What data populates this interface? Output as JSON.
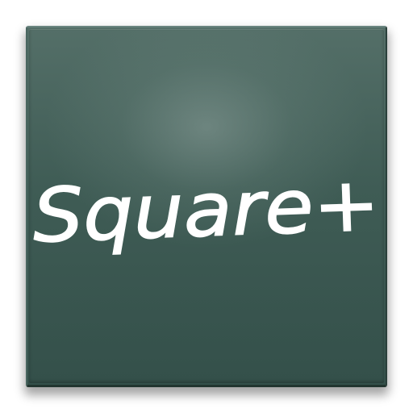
{
  "app": {
    "title": "Square+"
  },
  "colors": {
    "tile_top": "#546f68",
    "tile_bottom": "#34504a",
    "text": "#ffffff",
    "background": "#ffffff"
  }
}
